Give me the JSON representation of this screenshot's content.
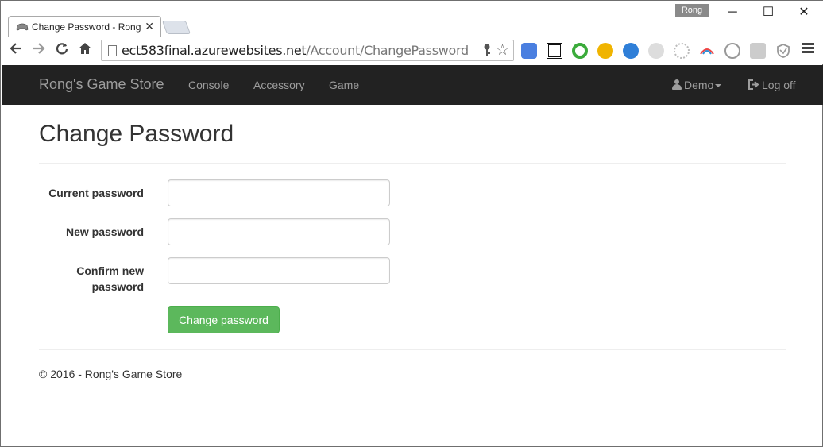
{
  "browser": {
    "tab_title": "Change Password - Rong's Game Store",
    "profile_name": "Rong",
    "url_host": "ect583final.azurewebsites.net",
    "url_path": "/Account/ChangePassword",
    "window_controls": {
      "minimize": "─",
      "maximize": "☐",
      "close": "✕"
    }
  },
  "navbar": {
    "brand": "Rong's Game Store",
    "links": [
      "Console",
      "Accessory",
      "Game"
    ],
    "user": "Demo",
    "logoff": "Log off"
  },
  "page": {
    "title": "Change Password",
    "fields": [
      {
        "label": "Current password",
        "value": ""
      },
      {
        "label": "New password",
        "value": ""
      },
      {
        "label": "Confirm new password",
        "value": ""
      }
    ],
    "submit_label": "Change password",
    "footer": "© 2016 - Rong's Game Store"
  },
  "colors": {
    "navbar_bg": "#222222",
    "nav_text": "#9d9d9d",
    "success": "#5cb85c"
  }
}
